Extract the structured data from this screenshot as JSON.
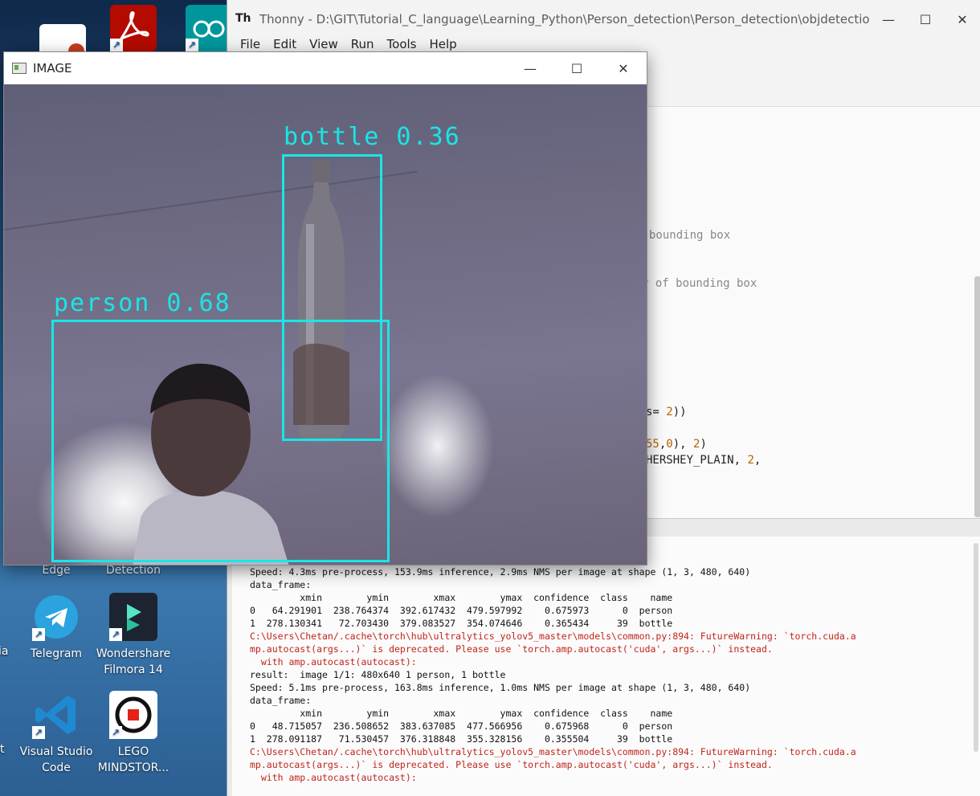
{
  "desktop": {
    "icons": [
      {
        "label": "Edge"
      },
      {
        "label": "Detection"
      },
      {
        "label": "Telegram"
      },
      {
        "label": "Wondershare Filmora 14"
      },
      {
        "label": "Visual Studio Code"
      },
      {
        "label": "LEGO MINDSTOR..."
      }
    ],
    "edge_labels": {
      "a": "ia",
      "b": "t"
    }
  },
  "thonny": {
    "title": "Thonny  -  D:\\GIT\\Tutorial_C_language\\Learning_Python\\Person_detection\\Person_detection\\objdetection.py...",
    "logo": "Th",
    "menu": [
      "File",
      "Edit",
      "View",
      "Run",
      "Tools",
      "Help"
    ],
    "editor_fragments": {
      "line1": "bounding box",
      "line2": "r of bounding box",
      "line3_a": "s= ",
      "line3_num": "2",
      "line3_b": "))",
      "line4_a": "55",
      "line4_b": ",",
      "line4_c": "0",
      "line4_d": "), ",
      "line4_e": "2",
      "line4_f": ")",
      "line5_a": "HERSHEY_PLAIN, ",
      "line5_num": "2",
      "line5_b": ","
    },
    "shell_lines": [
      {
        "text": "Speed: 4.3ms pre-process, 153.9ms inference, 2.9ms NMS per image at shape (1, 3, 480, 640)",
        "err": false
      },
      {
        "text": "data_frame:",
        "err": false
      },
      {
        "text": "         xmin        ymin        xmax        ymax  confidence  class    name",
        "err": false
      },
      {
        "text": "0   64.291901  238.764374  392.617432  479.597992    0.675973      0  person",
        "err": false
      },
      {
        "text": "1  278.130341   72.703430  379.083527  354.074646    0.365434     39  bottle",
        "err": false
      },
      {
        "text": "C:\\Users\\Chetan/.cache\\torch\\hub\\ultralytics_yolov5_master\\models\\common.py:894: FutureWarning: `torch.cuda.a",
        "err": true
      },
      {
        "text": "mp.autocast(args...)` is deprecated. Please use `torch.amp.autocast('cuda', args...)` instead.",
        "err": true
      },
      {
        "text": "  with amp.autocast(autocast):",
        "err": true
      },
      {
        "text": "result:  image 1/1: 480x640 1 person, 1 bottle",
        "err": false
      },
      {
        "text": "Speed: 5.1ms pre-process, 163.8ms inference, 1.0ms NMS per image at shape (1, 3, 480, 640)",
        "err": false
      },
      {
        "text": "data_frame:",
        "err": false
      },
      {
        "text": "         xmin        ymin        xmax        ymax  confidence  class    name",
        "err": false
      },
      {
        "text": "0   48.715057  236.508652  383.637085  477.566956    0.675968      0  person",
        "err": false
      },
      {
        "text": "1  278.091187   71.530457  376.318848  355.328156    0.355504     39  bottle",
        "err": false
      },
      {
        "text": "C:\\Users\\Chetan/.cache\\torch\\hub\\ultralytics_yolov5_master\\models\\common.py:894: FutureWarning: `torch.cuda.a",
        "err": true
      },
      {
        "text": "mp.autocast(args...)` is deprecated. Please use `torch.amp.autocast('cuda', args...)` instead.",
        "err": true
      },
      {
        "text": "  with amp.autocast(autocast):",
        "err": true
      }
    ]
  },
  "image_window": {
    "title": "IMAGE",
    "detections": [
      {
        "label": "bottle 0.36"
      },
      {
        "label": "person 0.68"
      }
    ],
    "box_color": "#19e6e6"
  },
  "window_buttons": {
    "minimize": "—",
    "maximize": "☐",
    "close": "✕"
  }
}
